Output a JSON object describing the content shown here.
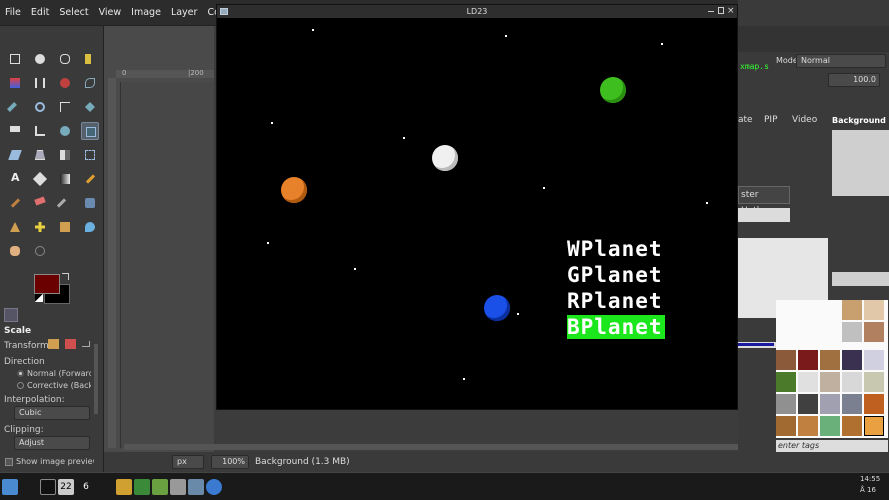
{
  "menu": [
    "File",
    "Edit",
    "Select",
    "View",
    "Image",
    "Layer",
    "Colors"
  ],
  "tool_options": {
    "title": "Scale",
    "transform_label": "Transform:",
    "direction_label": "Direction",
    "direction_normal": "Normal (Forward)",
    "direction_corrective": "Corrective (Backward)",
    "interpolation_label": "Interpolation:",
    "interpolation_value": "Cubic",
    "clipping_label": "Clipping:",
    "clipping_value": "Adjust",
    "show_preview": "Show image preview"
  },
  "ruler": {
    "t0": "0",
    "t1": "|200"
  },
  "game_window": {
    "title": "LD23",
    "labels": [
      "WPlanet",
      "GPlanet",
      "RPlanet",
      "BPlanet"
    ],
    "selected_label": "BPlanet",
    "planet_colors": {
      "green": "#3fbf1f",
      "white": "#f0f0f0",
      "orange": "#e8822a",
      "blue": "#1a4fe8"
    }
  },
  "right_panel": {
    "mode_label": "Mode:",
    "mode_value": "Normal",
    "opacity_value": "100.0",
    "xmap_text": "xmap.s",
    "tabs": [
      "ate",
      "PIP",
      "Video"
    ],
    "layer_name": "Background",
    "hotkey_button": "ster Hotkey",
    "tags_placeholder": "enter tags"
  },
  "statusbar": {
    "unit": "px",
    "zoom": "100%",
    "layer_info": "Background (1.3 MB)"
  },
  "taskbar": {
    "items": [
      "22",
      "6"
    ],
    "clock_time": "14:55",
    "clock_label": "Å 16"
  }
}
